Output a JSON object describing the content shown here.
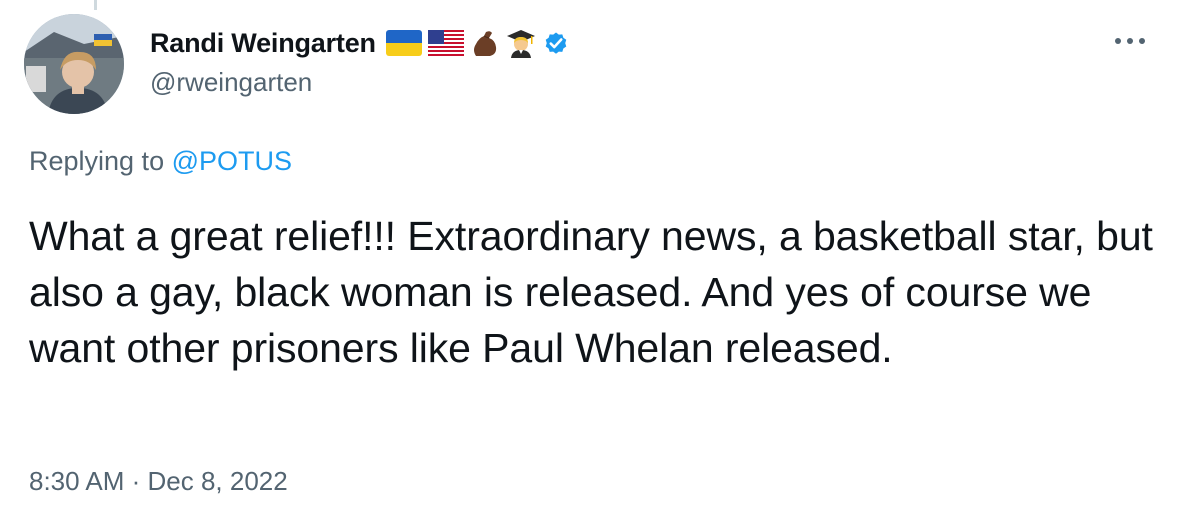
{
  "author": {
    "display_name": "Randi Weingarten",
    "handle": "@rweingarten",
    "badges": [
      "ukraine-flag-icon",
      "us-flag-icon",
      "flexed-biceps-icon",
      "teacher-icon",
      "verified-badge-icon"
    ]
  },
  "reply": {
    "prefix": "Replying to",
    "mention": "@POTUS"
  },
  "tweet": {
    "text": "What a great relief!!! Extraordinary news, a basketball star, but also a gay, black woman is released. And yes of course we want other prisoners like Paul Whelan released.",
    "timestamp": "8:30 AM · Dec 8, 2022"
  },
  "colors": {
    "text": "#0f1419",
    "secondary": "#536471",
    "link": "#1d9bf0",
    "verified": "#1d9bf0"
  }
}
